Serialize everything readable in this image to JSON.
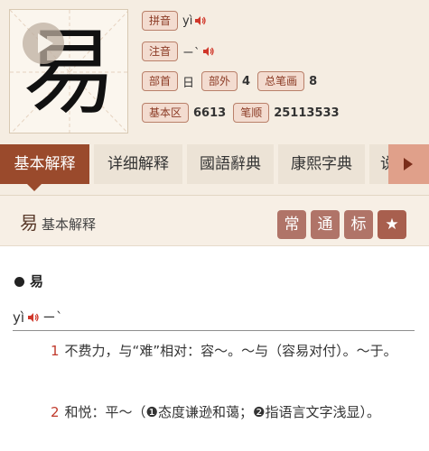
{
  "character": {
    "glyph": "易"
  },
  "info": {
    "pinyin_label": "拼音",
    "pinyin_value": "yì",
    "zhuyin_label": "注音",
    "zhuyin_value": "ㄧˋ",
    "radical_label": "部首",
    "radical_value": "日",
    "outside_strokes_label": "部外",
    "outside_strokes_value": "4",
    "total_strokes_label": "总笔画",
    "total_strokes_value": "8",
    "basic_area_label": "基本区",
    "basic_area_value": "6613",
    "stroke_order_label": "笔顺",
    "stroke_order_value": "25113533"
  },
  "tabs": [
    {
      "label": "基本解释"
    },
    {
      "label": "详细解释"
    },
    {
      "label": "國語辭典"
    },
    {
      "label": "康熙字典"
    },
    {
      "label": "说"
    }
  ],
  "card": {
    "title_char": "易",
    "title_text": "基本解释",
    "badges": [
      "常",
      "通",
      "标",
      "★"
    ],
    "entry_word": "易",
    "pron_pinyin": "yì",
    "pron_zhuyin": "ㄧˋ",
    "definitions": [
      {
        "num": "1",
        "text": "不费力，与“难”相对：容～。～与（容易对付）。～于。"
      },
      {
        "num": "2",
        "text": "和悦：平～（❶态度谦逊和蔼；❷指语言文字浅显）。"
      }
    ]
  },
  "colors": {
    "accent": "#9a4a2c",
    "tag_bg": "#f3dcd0",
    "badge": "#b07468",
    "speaker": "#d0372a"
  }
}
